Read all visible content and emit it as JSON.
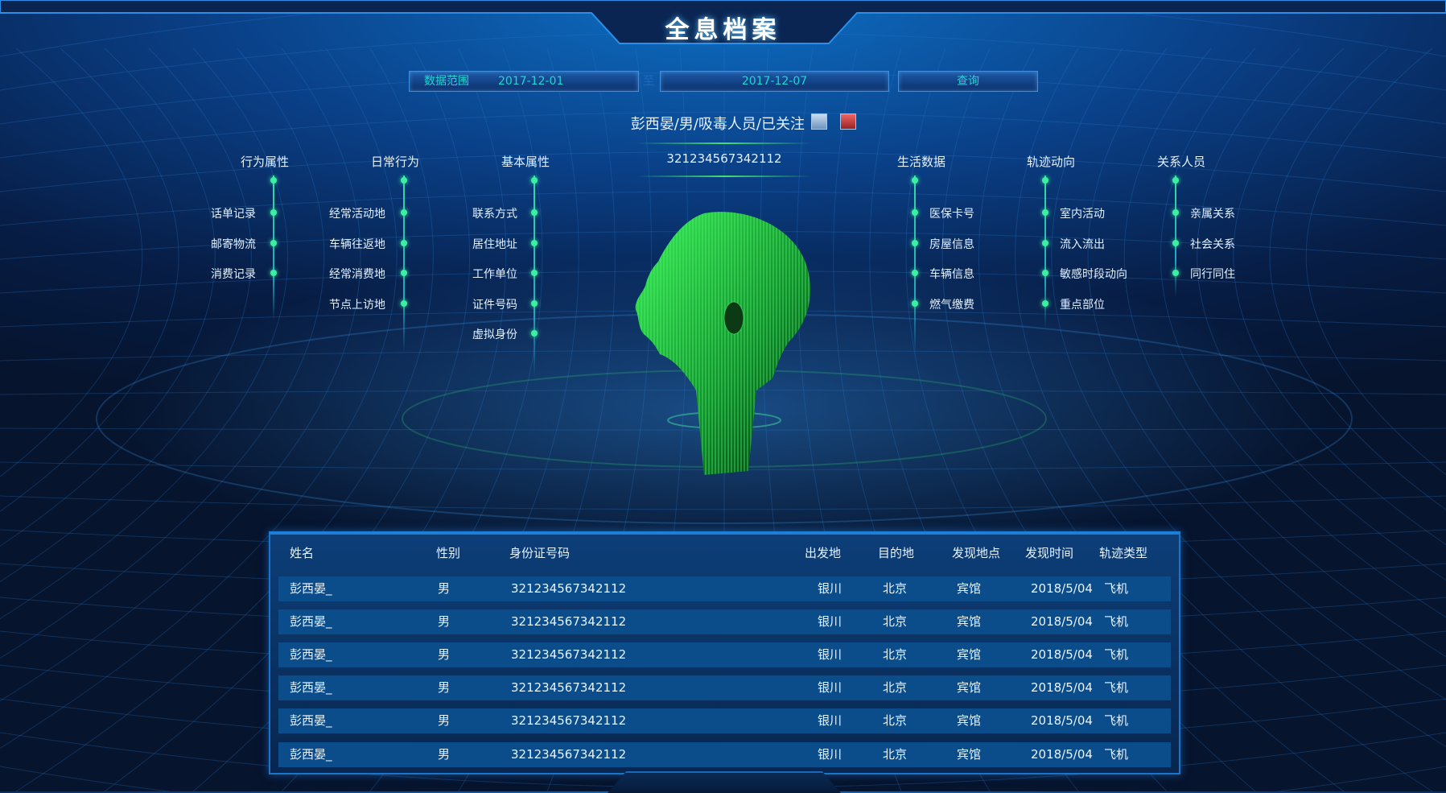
{
  "header": {
    "title": "全息档案"
  },
  "search": {
    "range_label": "数据范围",
    "start_date": "2017-12-01",
    "separator": "至",
    "end_date": "2017-12-07",
    "query_label": "查询"
  },
  "person": {
    "summary": "彭西晏/男/吸毒人员/已关注",
    "id_number": "321234567342112",
    "icons": [
      "user-photo-icon",
      "user-avatar-icon"
    ]
  },
  "categories": {
    "left": [
      {
        "title": "行为属性",
        "items": [
          "话单记录",
          "邮寄物流",
          "消费记录"
        ]
      },
      {
        "title": "日常行为",
        "items": [
          "经常活动地",
          "车辆往返地",
          "经常消费地",
          "节点上访地"
        ]
      },
      {
        "title": "基本属性",
        "items": [
          "联系方式",
          "居住地址",
          "工作单位",
          "证件号码",
          "虚拟身份"
        ]
      }
    ],
    "right": [
      {
        "title": "生活数据",
        "items": [
          "医保卡号",
          "房屋信息",
          "车辆信息",
          "燃气缴费"
        ]
      },
      {
        "title": "轨迹动向",
        "items": [
          "室内活动",
          "流入流出",
          "敏感时段动向",
          "重点部位"
        ]
      },
      {
        "title": "关系人员",
        "items": [
          "亲属关系",
          "社会关系",
          "同行同住"
        ]
      }
    ]
  },
  "table": {
    "headers": [
      "姓名",
      "性别",
      "身份证号码",
      "出发地",
      "目的地",
      "发现地点",
      "发现时间",
      "轨迹类型"
    ],
    "rows": [
      [
        "彭西晏_",
        "男",
        "321234567342112",
        "银川",
        "北京",
        "宾馆",
        "2018/5/04",
        "飞机"
      ],
      [
        "彭西晏_",
        "男",
        "321234567342112",
        "银川",
        "北京",
        "宾馆",
        "2018/5/04",
        "飞机"
      ],
      [
        "彭西晏_",
        "男",
        "321234567342112",
        "银川",
        "北京",
        "宾馆",
        "2018/5/04",
        "飞机"
      ],
      [
        "彭西晏_",
        "男",
        "321234567342112",
        "银川",
        "北京",
        "宾馆",
        "2018/5/04",
        "飞机"
      ],
      [
        "彭西晏_",
        "男",
        "321234567342112",
        "银川",
        "北京",
        "宾馆",
        "2018/5/04",
        "飞机"
      ],
      [
        "彭西晏_",
        "男",
        "321234567342112",
        "银川",
        "北京",
        "宾馆",
        "2018/5/04",
        "飞机"
      ]
    ]
  },
  "colors": {
    "accent": "#1fd7d0",
    "node": "#3bf0a0",
    "panel": "#0b4c8a",
    "hologram": "#2fd24a"
  }
}
